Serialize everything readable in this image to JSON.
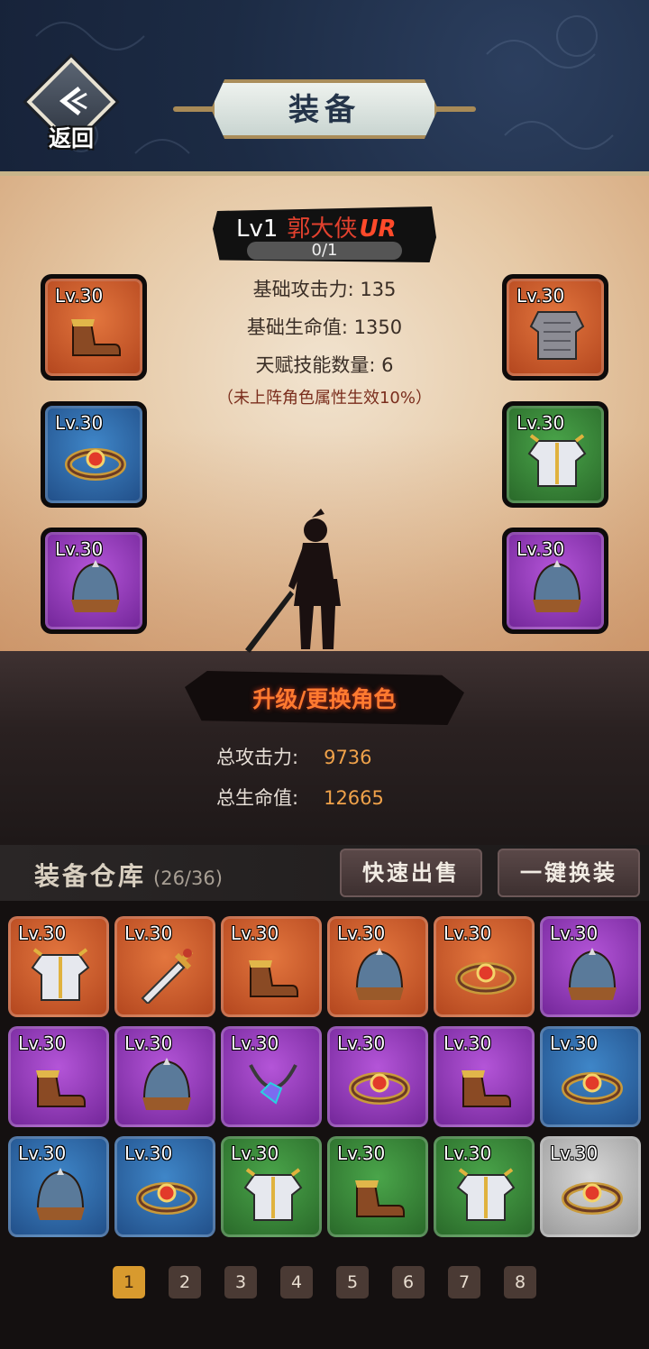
{
  "header": {
    "back_label": "返回",
    "title": "装备"
  },
  "hero": {
    "level": "Lv1",
    "name": "郭大侠",
    "rank": "UR",
    "exp": "0/1",
    "stats": [
      "基础攻击力: 135",
      "基础生命值: 1350",
      "天赋技能数量: 6"
    ],
    "note": "（未上阵角色属性生效10%）"
  },
  "equipped": [
    {
      "level": "Lv.30",
      "icon": "boots-icon",
      "rarity": "orange"
    },
    {
      "level": "Lv.30",
      "icon": "ring-icon",
      "rarity": "blue"
    },
    {
      "level": "Lv.30",
      "icon": "helmet-icon",
      "rarity": "purple"
    },
    {
      "level": "Lv.30",
      "icon": "chainmail-icon",
      "rarity": "orange"
    },
    {
      "level": "Lv.30",
      "icon": "armor-icon",
      "rarity": "green"
    },
    {
      "level": "Lv.30",
      "icon": "helmet-icon",
      "rarity": "purple"
    }
  ],
  "swap_label": "升级/更换角色",
  "totals": {
    "attack_label": "总攻击力:",
    "attack_value": "9736",
    "hp_label": "总生命值:",
    "hp_value": "12665"
  },
  "warehouse": {
    "title": "装备仓库",
    "count": "(26/36)",
    "sell_label": "快速出售",
    "equip_label": "一键换装",
    "items": [
      {
        "level": "Lv.30",
        "icon": "armor-icon",
        "rarity": "orange"
      },
      {
        "level": "Lv.30",
        "icon": "sword-icon",
        "rarity": "orange"
      },
      {
        "level": "Lv.30",
        "icon": "boots-icon",
        "rarity": "orange"
      },
      {
        "level": "Lv.30",
        "icon": "helmet-icon",
        "rarity": "orange"
      },
      {
        "level": "Lv.30",
        "icon": "ring-icon",
        "rarity": "orange"
      },
      {
        "level": "Lv.30",
        "icon": "helmet-icon",
        "rarity": "purple"
      },
      {
        "level": "Lv.30",
        "icon": "boots-icon",
        "rarity": "purple"
      },
      {
        "level": "Lv.30",
        "icon": "helmet-icon",
        "rarity": "purple"
      },
      {
        "level": "Lv.30",
        "icon": "necklace-icon",
        "rarity": "purple"
      },
      {
        "level": "Lv.30",
        "icon": "ring-icon",
        "rarity": "purple"
      },
      {
        "level": "Lv.30",
        "icon": "boots-icon",
        "rarity": "purple"
      },
      {
        "level": "Lv.30",
        "icon": "ring-icon",
        "rarity": "blue"
      },
      {
        "level": "Lv.30",
        "icon": "helmet-icon",
        "rarity": "blue"
      },
      {
        "level": "Lv.30",
        "icon": "ring-icon",
        "rarity": "blue"
      },
      {
        "level": "Lv.30",
        "icon": "armor-icon",
        "rarity": "green"
      },
      {
        "level": "Lv.30",
        "icon": "boots-icon",
        "rarity": "green"
      },
      {
        "level": "Lv.30",
        "icon": "armor-icon",
        "rarity": "green"
      },
      {
        "level": "Lv.30",
        "icon": "ring-icon",
        "rarity": "grey"
      }
    ]
  },
  "pagination": {
    "pages": [
      "1",
      "2",
      "3",
      "4",
      "5",
      "6",
      "7",
      "8"
    ],
    "active": "1"
  },
  "colors": {
    "orange": "#c8552a",
    "blue": "#2f6aa8",
    "purple": "#8f37b8",
    "green": "#378537",
    "grey": "#bcbcbc",
    "accent": "#d89a2e"
  }
}
